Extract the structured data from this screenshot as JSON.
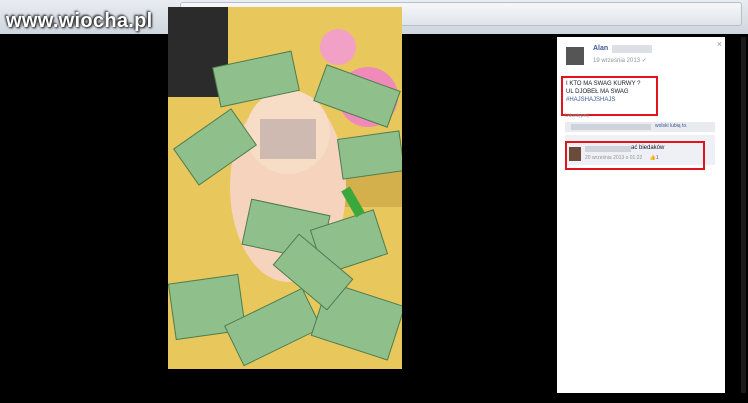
{
  "watermark": "www.wiocha.pl",
  "post": {
    "author": "Alan",
    "date": "19 września 2013 ✓",
    "line1": "I KTO MA SWAG KURWY ?",
    "line2": "UL DJOBEŁ MA SWAG",
    "tags": "#HAJSHAJSHAJS",
    "share": "Udostępnij",
    "likes_suffix": "wolski lubią to."
  },
  "comment": {
    "text": "ać biedaków",
    "time": "20 września 2013 o 01:22",
    "likes": "👍1"
  },
  "close": "×",
  "colors": {
    "highlight": "#e0141a",
    "link": "#3b5998"
  }
}
